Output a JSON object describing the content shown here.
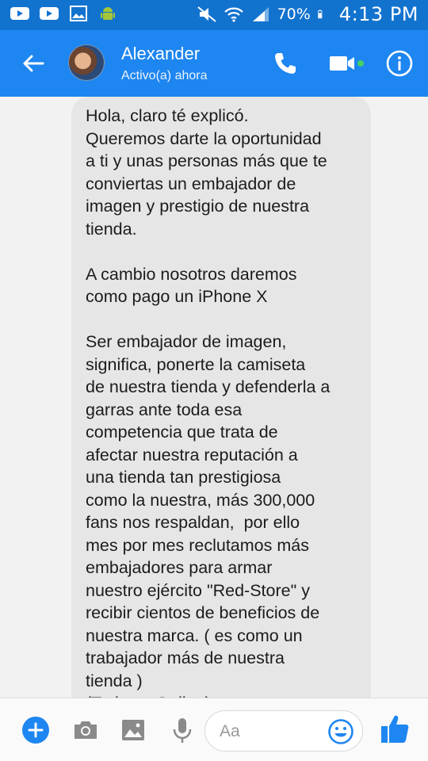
{
  "status_bar": {
    "battery": "70%",
    "time": "4:13 PM"
  },
  "header": {
    "contact_name": "Alexander",
    "contact_status": "Activo(a) ahora"
  },
  "message": {
    "text": "Hola, claro té explicó.\nQueremos darte la oportunidad\na ti y unas personas más que te\nconviertas un embajador de\nimagen y prestigio de nuestra\ntienda.\n\nA cambio nosotros daremos\ncomo pago un iPhone X\n\nSer embajador de imagen,\nsignifica, ponerte la camiseta\nde nuestra tienda y defenderla a\ngarras ante toda esa\ncompetencia que trata de\nafectar nuestra reputación a\nuna tienda tan prestigiosa\ncomo la nuestra, más 300,000\nfans nos respaldan,  por ello\nmes por mes reclutamos más\nembajadores para armar\nnuestro ejército \"Red-Store\" y\nrecibir cientos de beneficios de\nnuestra marca. ( es como un\ntrabajador más de nuestra\ntienda )\n(Todo es Online)"
  },
  "composer": {
    "placeholder": "Aa"
  },
  "colors": {
    "status_bar": "#1273cf",
    "header": "#1e86f0",
    "accent": "#1e86f0",
    "bubble": "#e6e6e6",
    "online": "#44d162"
  },
  "icons": {
    "status_left": [
      "youtube-icon",
      "youtube-icon",
      "image-icon",
      "android-icon"
    ],
    "status_right": [
      "mute-icon",
      "wifi-icon",
      "signal-icon",
      "battery-icon"
    ],
    "header": [
      "back-arrow-icon",
      "phone-icon",
      "video-camera-icon",
      "info-icon"
    ],
    "composer": [
      "plus-icon",
      "camera-icon",
      "image-icon",
      "microphone-icon",
      "emoji-icon",
      "thumbs-up-icon"
    ]
  }
}
